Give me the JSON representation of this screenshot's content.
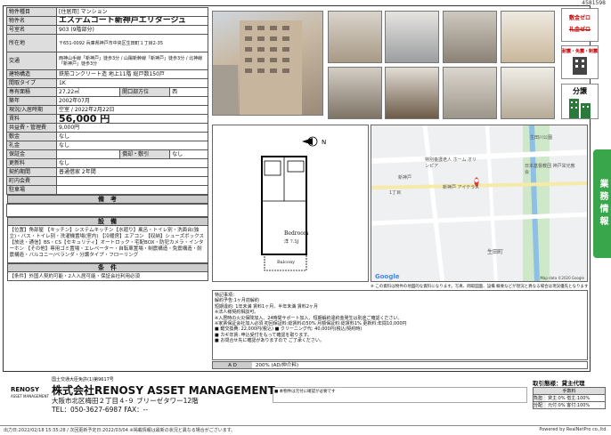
{
  "ref_number": "4581598",
  "spec": {
    "rows": [
      {
        "label": "物件種目",
        "value": "[住居用] マンション"
      },
      {
        "label": "物件名",
        "value": "エステムコート新神戸エリタージュ"
      },
      {
        "label": "号室名",
        "value": "903 (9階部分)"
      },
      {
        "label": "所在地",
        "value": "〒651-0092 兵庫県神戸市中央区生田町１丁目2-35"
      },
      {
        "label": "交通",
        "value": "西神山手線「新神戸」徒歩3分 / 山陽新幹線「新神戸」徒歩3分 / 北神線「新神戸」徒歩3分"
      },
      {
        "label": "建物構造",
        "value": "鉄筋コンクリート造 地上11階 総戸数150戸"
      },
      {
        "label": "間取タイプ",
        "value": "1K"
      },
      {
        "label": "専有面積",
        "value": "27.22㎡"
      },
      {
        "label": "築年",
        "value": "2002年07月"
      },
      {
        "label": "現況/入居時期",
        "value": "空室 / 2022年2月22日"
      },
      {
        "label": "賃料",
        "value": "56,000 円"
      },
      {
        "label": "共益費・管理費",
        "value": "9,000円"
      },
      {
        "label": "敷金",
        "value": "なし"
      },
      {
        "label": "礼金",
        "value": "なし"
      },
      {
        "label": "保証金",
        "value": ""
      },
      {
        "label": "更新料",
        "value": "なし"
      },
      {
        "label": "契約期間",
        "value": "普通借家 2年間"
      },
      {
        "label": "町内会費",
        "value": ""
      },
      {
        "label": "駐車場",
        "value": ""
      }
    ],
    "opening_label": "開口部方位",
    "opening_value": "西",
    "amort_label": "償却・敷引",
    "amort_value": "なし",
    "remarks_header": "備　考",
    "facilities_header": "設　備",
    "facilities_text": "【位置】角部屋 【キッチン】システムキッチン【水廻り】風呂・トイレ別・洗面台(独立)・バス・トイレ別・洗濯機置場(室内) 【冷暖房】エアコン 【収納】シューズボックス【放送・通信】BS・CS【セキュリティ】オートロック・宅配BOX・防犯カメラ・インターホン 【その他】専用ゴミ置場・エレベーター・自転車置場・制震構造・免震構造・耐震構造・バルコニー/ベランダ・分譲タイプ・フローリング",
    "conditions_header": "条　件",
    "conditions_text": "【条件】外国人契約可能・2人入居可能・保証会社利用必須"
  },
  "badges": [
    {
      "label": "敷金ゼロ",
      "sub": "礼金ゼロ"
    },
    {
      "label": "耐震・免震・制震"
    },
    {
      "label": "分譲"
    }
  ],
  "side_button": "業務情報",
  "floorplan": {
    "room_label": "Bedroom",
    "room_size": "洋 7.5J",
    "balcony": "Balcony"
  },
  "map": {
    "caption": "※ この資料は物件の地図的な資料になります。写真、間取図面、設備 概要などが現況と異なる場合は現況優先となります。",
    "google": "Google",
    "map_data": "Map data ©2020 Google",
    "labels": [
      "新神戸",
      "生田町",
      "日本基督教団 神戸栄光教会",
      "特別養護老人 ホーム オリンピア",
      "新神戸 アイテラス",
      "1丁目",
      "生田川公園"
    ]
  },
  "notes": {
    "text": "特記事項：\n解約予告:1ヶ月前解約\n短期違約: 1年未満 賃料1ヶ月、半年未満 賃料2ヶ月\n※法人様契約相談可。\n※入居時の火災保険加入、24時間サポート加入、短期解約違約金発生は別途ご確認ください。\n※家賃保証会社加入必須 初回保証料:総賃料の50% 月額保証料:総賃料1% 更新料:年間10,000円\n■ 鍵交換費: 22,000円(税込) ■ クリーニング代: 40,000円(税込/契約時)\n■ カギ年賃: 申込受付をもって確認を取ります。\n■ お問合せ先に確認がありますので ご了承ください。",
    "ad_label": "A D",
    "ad_value": "200% (AD/仲介料)"
  },
  "company": {
    "logo": "RENOSY",
    "logo_sub": "ASSET MANAGEMENT",
    "license": "国土交通大臣免許(1)第9617号",
    "name": "株式会社RENOSY ASSET MANAGEMENT",
    "address": "大阪市北区梅田２丁目４-９ ブリーゼタワー12階",
    "tel": "TEL：050-3627-6987 FAX：--"
  },
  "trade": {
    "title": "取引態様：貸主代理",
    "fee_header": "手数料",
    "rows": [
      {
        "k": "負担",
        "v": "貸主:0% 借主:100%"
      },
      {
        "k": "分配",
        "v": "元付:0% 客付:100%"
      }
    ]
  },
  "midnote": "■ 本物件は元付に確認が必要です",
  "footer": {
    "left": "出力日:2022/02/18 15:35:28 / 次回更新予定日:2022/03/04 ※掲載情報は最新の状況と異なる場合がございます。",
    "right": "Powered by RealNetPro co.,ltd."
  }
}
